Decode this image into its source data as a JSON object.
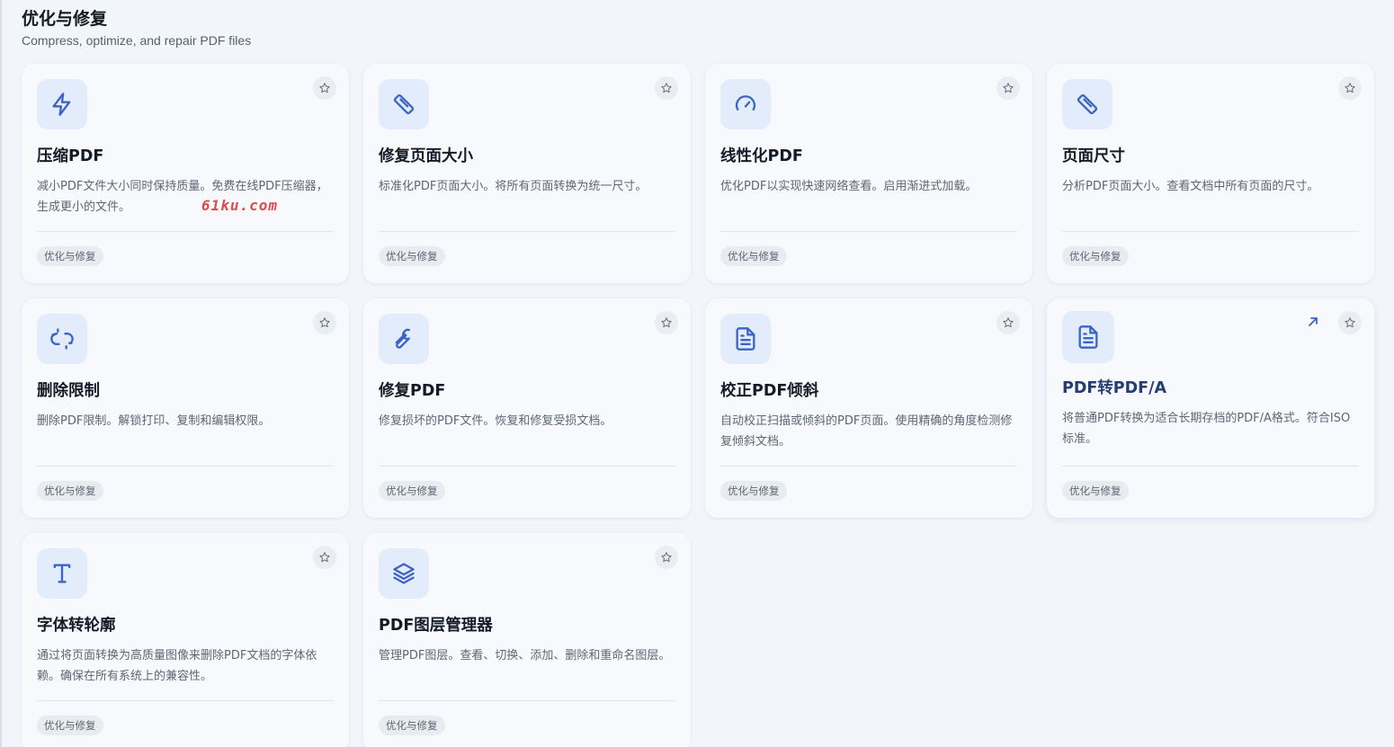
{
  "header": {
    "title": "优化与修复",
    "subtitle": "Compress, optimize, and repair PDF files"
  },
  "colors": {
    "accent": "#3d64c4",
    "icon_bg": "#e2ecfa",
    "page_bg": "#f2f5fa",
    "card_bg": "#f7f9fc"
  },
  "cards": [
    {
      "title": "压缩PDF",
      "description": "减小PDF文件大小同时保持质量。免费在线PDF压缩器，生成更小的文件。",
      "tag": "优化与修复",
      "icon": "lightning-icon"
    },
    {
      "title": "修复页面大小",
      "description": "标准化PDF页面大小。将所有页面转换为统一尺寸。",
      "tag": "优化与修复",
      "icon": "ruler-icon"
    },
    {
      "title": "线性化PDF",
      "description": "优化PDF以实现快速网络查看。启用渐进式加载。",
      "tag": "优化与修复",
      "icon": "gauge-icon"
    },
    {
      "title": "页面尺寸",
      "description": "分析PDF页面大小。查看文档中所有页面的尺寸。",
      "tag": "优化与修复",
      "icon": "ruler-icon"
    },
    {
      "title": "删除限制",
      "description": "删除PDF限制。解锁打印、复制和编辑权限。",
      "tag": "优化与修复",
      "icon": "broken-link-icon"
    },
    {
      "title": "修复PDF",
      "description": "修复损坏的PDF文件。恢复和修复受损文档。",
      "tag": "优化与修复",
      "icon": "wrench-icon"
    },
    {
      "title": "校正PDF倾斜",
      "description": "自动校正扫描或倾斜的PDF页面。使用精确的角度检测修复倾斜文档。",
      "tag": "优化与修复",
      "icon": "document-icon"
    },
    {
      "title": "PDF转PDF/A",
      "description": "将普通PDF转换为适合长期存档的PDF/A格式。符合ISO标准。",
      "tag": "优化与修复",
      "icon": "document-icon",
      "highlighted": true
    },
    {
      "title": "字体转轮廓",
      "description": "通过将页面转换为高质量图像来删除PDF文档的字体依赖。确保在所有系统上的兼容性。",
      "tag": "优化与修复",
      "icon": "text-icon"
    },
    {
      "title": "PDF图层管理器",
      "description": "管理PDF图层。查看、切换、添加、删除和重命名图层。",
      "tag": "优化与修复",
      "icon": "layers-icon"
    }
  ],
  "watermark": "61ku.com"
}
